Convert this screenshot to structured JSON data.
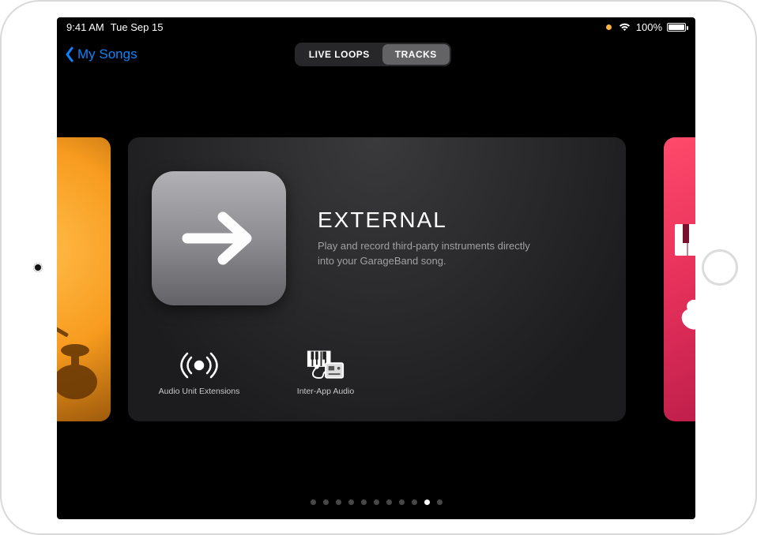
{
  "status_bar": {
    "time": "9:41 AM",
    "date": "Tue Sep 15",
    "battery_percent": "100%"
  },
  "nav": {
    "back_label": "My Songs",
    "segments": {
      "live_loops": "LIVE LOOPS",
      "tracks": "TRACKS",
      "selected": "tracks"
    }
  },
  "browser": {
    "main_card": {
      "title": "EXTERNAL",
      "description": "Play and record third-party instruments directly into your GarageBand song.",
      "icon_name": "arrow-right-icon",
      "sub_items": [
        {
          "label": "Audio Unit Extensions",
          "icon": "broadcast-dot-icon"
        },
        {
          "label": "Inter-App Audio",
          "icon": "keyboard-module-icon"
        }
      ]
    },
    "page_indicator": {
      "count": 11,
      "active_index": 9
    }
  }
}
